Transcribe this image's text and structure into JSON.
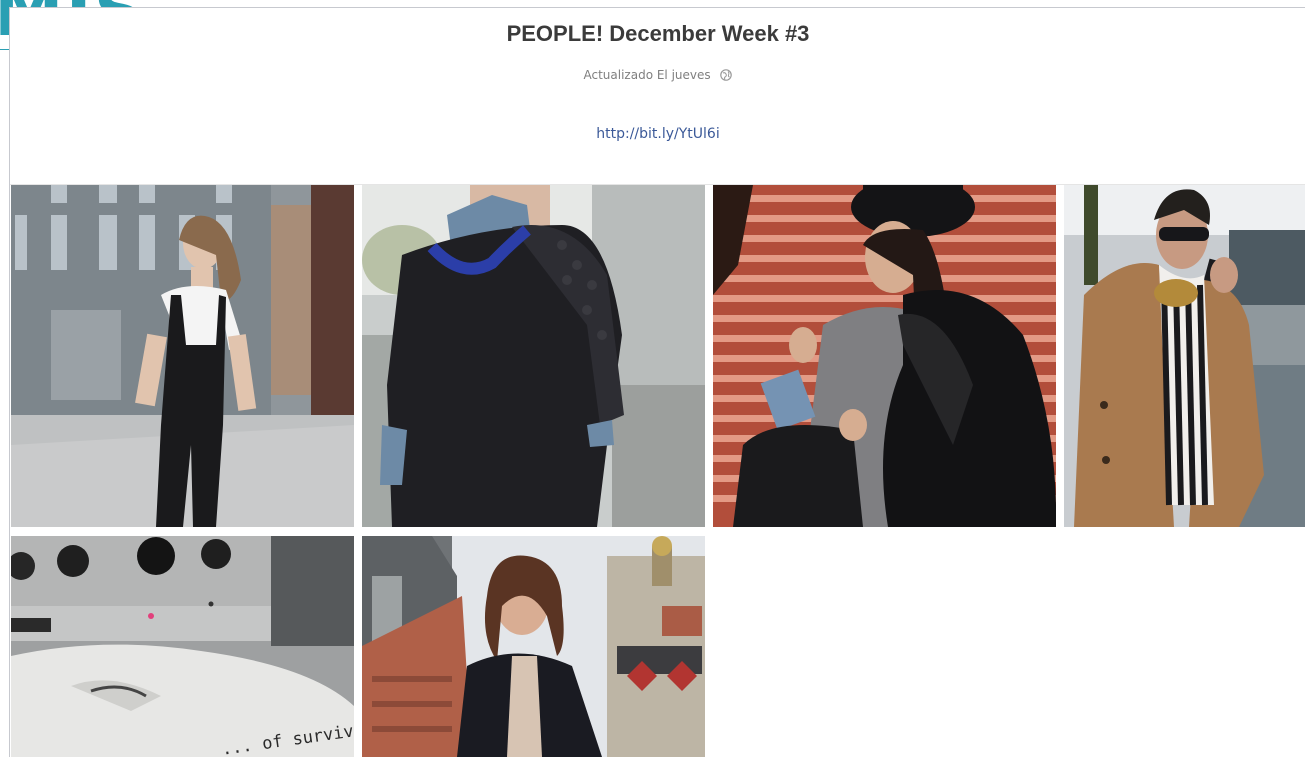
{
  "album": {
    "title": "PEOPLE! December Week #3",
    "updated": "Actualizado El jueves",
    "privacy_icon": "globe-icon",
    "link": "http://bit.ly/YtUl6i"
  },
  "photos": [
    {
      "id": "photo-1",
      "subject": "woman-black-overalls"
    },
    {
      "id": "photo-2",
      "subject": "black-sweater-necklace"
    },
    {
      "id": "photo-3",
      "subject": "woman-hat-fur-coat"
    },
    {
      "id": "photo-4",
      "subject": "woman-camel-coat-phone"
    },
    {
      "id": "photo-5",
      "subject": "amplifier-knobs-tshirt"
    },
    {
      "id": "photo-6",
      "subject": "woman-black-coat-rooftops"
    }
  ],
  "photo5_caption": "... of survival.",
  "colors": {
    "link": "#3b5998",
    "title": "#3b3b3b",
    "meta": "#7f7f7f",
    "border": "#c7c9cf",
    "logo": "#2a9fb3"
  }
}
